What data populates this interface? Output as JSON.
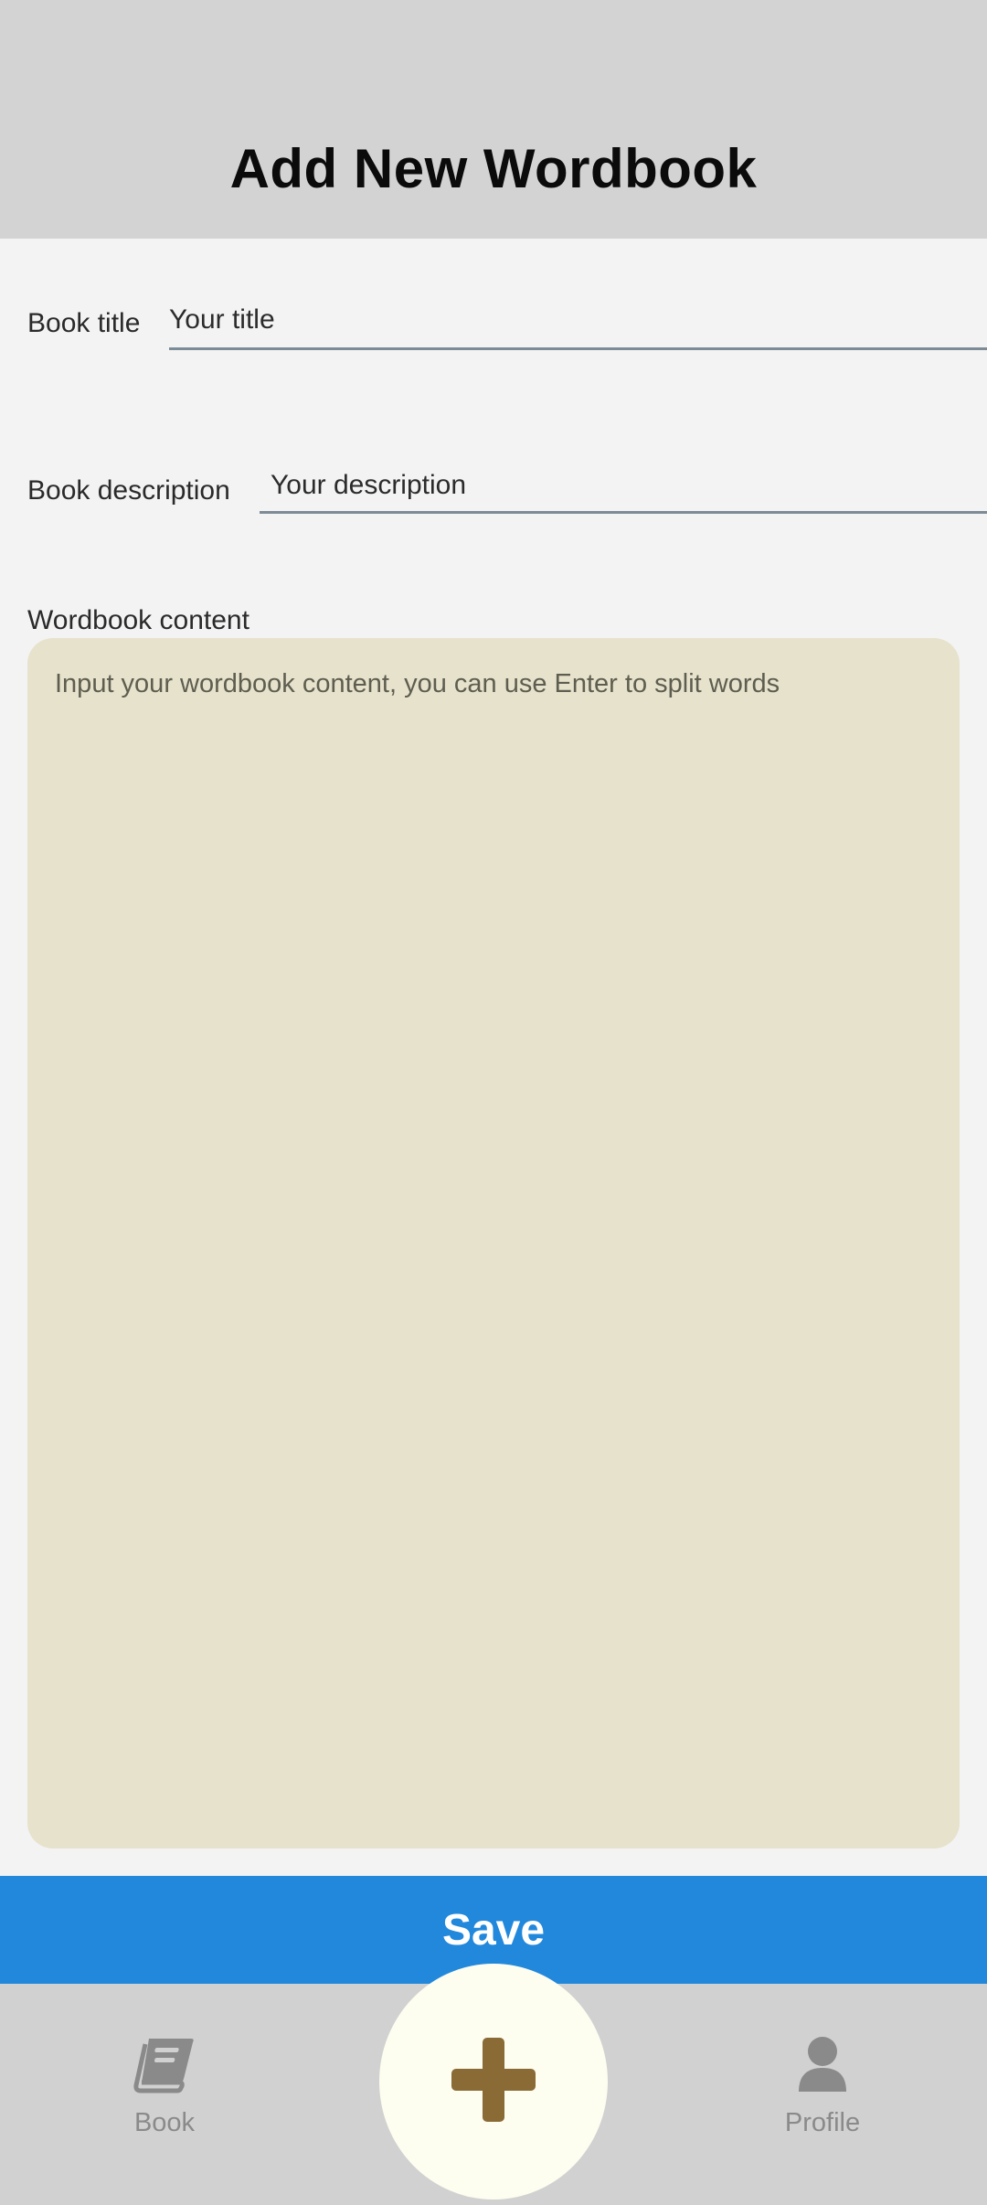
{
  "header": {
    "title": "Add New Wordbook"
  },
  "form": {
    "title_label": "Book title",
    "title_placeholder": "Your title",
    "description_label": "Book description",
    "description_placeholder": "Your description",
    "content_label": "Wordbook content",
    "content_placeholder": "Input your wordbook content, you can use Enter to split words"
  },
  "actions": {
    "save_label": "Save"
  },
  "bottom_nav": {
    "items": [
      {
        "label": "Book",
        "icon": "book-icon"
      },
      {
        "label": "Profile",
        "icon": "profile-icon"
      }
    ],
    "fab_icon": "plus-icon"
  },
  "colors": {
    "header_bg": "#d3d3d3",
    "save_button": "#2288dc",
    "textarea_bg": "#e7e2cc",
    "fab_plus": "#8a6a35",
    "nav_inactive": "#8a8a8a"
  }
}
